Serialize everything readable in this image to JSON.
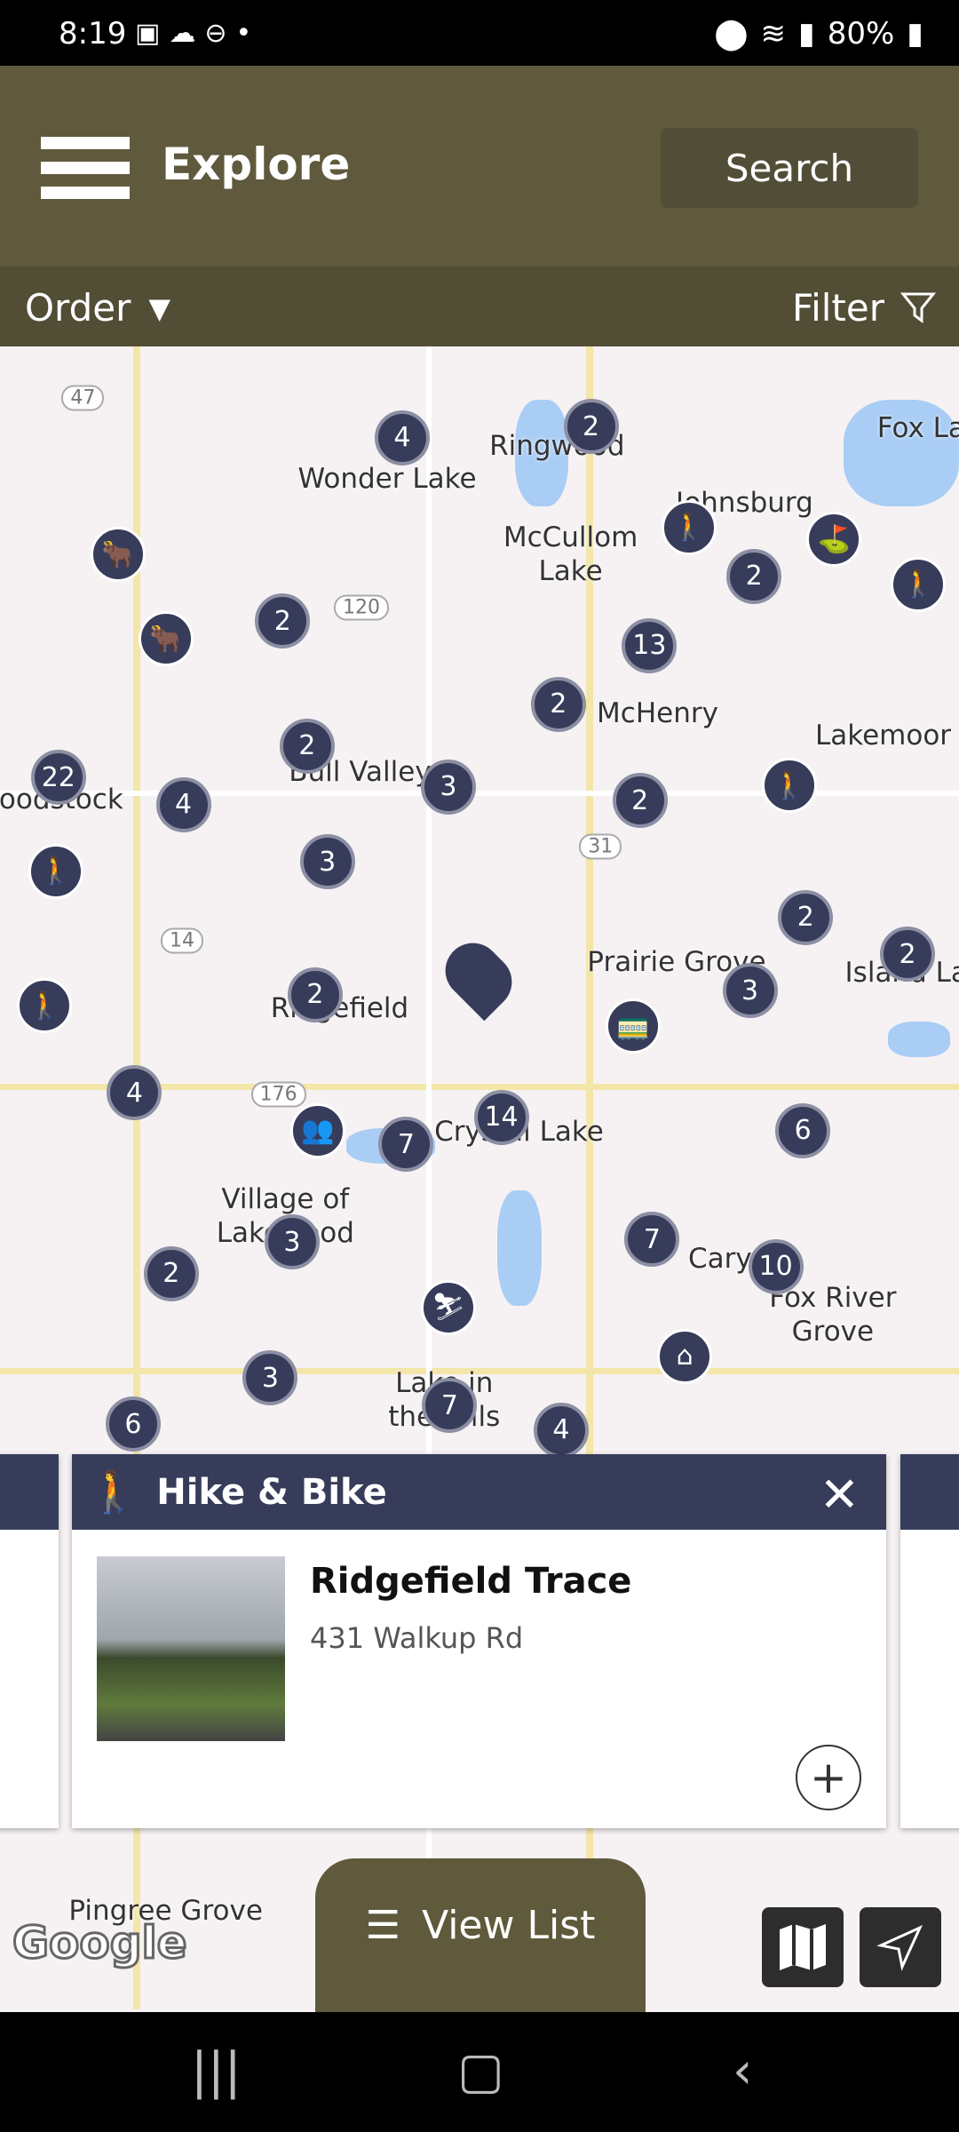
{
  "status_bar": {
    "time": "8:19",
    "battery": "80%",
    "icons_left": [
      "gallery-icon",
      "cloud-icon",
      "dnd-icon",
      "dot-icon"
    ],
    "icons_right": [
      "location-icon",
      "wifi-icon",
      "signal-icon",
      "battery-icon"
    ]
  },
  "header": {
    "title": "Explore",
    "search_label": "Search"
  },
  "subbar": {
    "order_label": "Order",
    "filter_label": "Filter"
  },
  "map": {
    "clusters": [
      "4",
      "2",
      "2",
      "13",
      "2",
      "2",
      "2",
      "22",
      "4",
      "3",
      "2",
      "3",
      "2",
      "2",
      "3",
      "2",
      "4",
      "7",
      "14",
      "6",
      "3",
      "2",
      "7",
      "10",
      "3",
      "7",
      "6",
      "4"
    ],
    "pois": [
      "hiker-icon",
      "hiker-icon",
      "hiker-icon",
      "hiker-icon",
      "hiker-icon",
      "bull-icon",
      "bull-icon",
      "golf-icon",
      "train-icon",
      "group-icon",
      "skier-icon",
      "barn-icon"
    ],
    "place_labels": [
      "Wonder Lake",
      "Ringwood",
      "McCullom\nLake",
      "Johnsburg",
      "Fox La",
      "McHenry",
      "Lakemoor",
      "Bull Valley",
      "oodstock",
      "Prairie Grove",
      "Island Lak",
      "Ridgefield",
      "Crystal Lake",
      "Village of\nLakewood",
      "Cary",
      "Fox River\nGrove",
      "Lake in\nthe Hills",
      "Pingree Grove"
    ],
    "road_shields": [
      "47",
      "120",
      "31",
      "14",
      "176"
    ],
    "attribution": "Google"
  },
  "card": {
    "category": "Hike & Bike",
    "name": "Ridgefield Trace",
    "address": "431 Walkup Rd"
  },
  "view_list_label": "View List",
  "colors": {
    "header": "#5f5a3d",
    "subbar": "#524d35",
    "card_header": "#363c5a",
    "marker": "#363c5a"
  }
}
